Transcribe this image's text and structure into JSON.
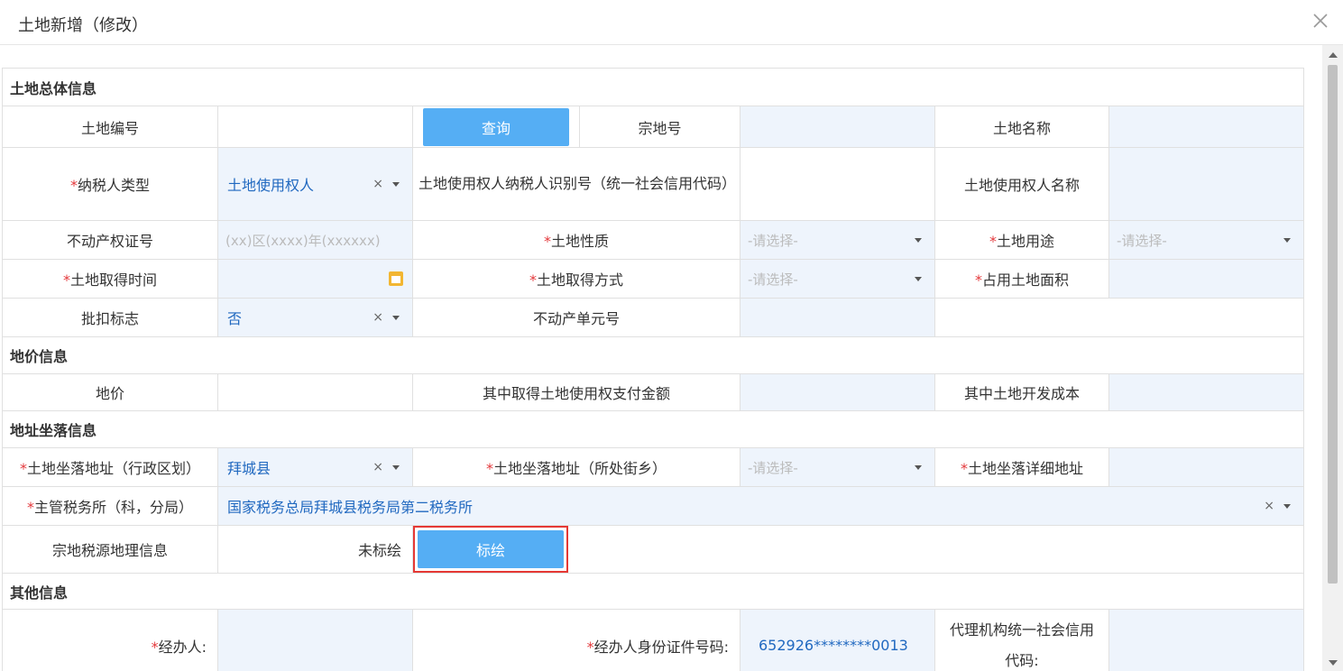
{
  "dialog": {
    "title": "土地新增（修改）"
  },
  "sections": {
    "general": "土地总体信息",
    "price": "地价信息",
    "address": "地址坐落信息",
    "other": "其他信息"
  },
  "fields": {
    "land_no": "土地编号",
    "query_button": "查询",
    "parcel_no": "宗地号",
    "land_name": "土地名称",
    "taxpayer_type": "纳税人类型",
    "taxpayer_type_value": "土地使用权人",
    "user_tax_id": "土地使用权人纳税人识别号（统一社会信用代码）",
    "user_name": "土地使用权人名称",
    "property_cert_no": "不动产权证号",
    "property_cert_placeholder": "(xx)区(xxxx)年(xxxxxx)",
    "land_nature": "土地性质",
    "land_use": "土地用途",
    "select_placeholder": "-请选择-",
    "acquire_time": "土地取得时间",
    "acquire_method": "土地取得方式",
    "occupied_area": "占用土地面积",
    "deduction_flag": "批扣标志",
    "deduction_flag_value": "否",
    "property_unit_no": "不动产单元号",
    "land_price": "地价",
    "use_right_payment": "其中取得土地使用权支付金额",
    "development_cost": "其中土地开发成本",
    "addr_district": "土地坐落地址（行政区划）",
    "addr_district_value": "拜城县",
    "addr_street": "土地坐落地址（所处街乡）",
    "addr_detail": "土地坐落详细地址",
    "tax_office": "主管税务所（科，分局）",
    "tax_office_value": "国家税务总局拜城县税务局第二税务所",
    "geo_info": "宗地税源地理信息",
    "geo_status": "未标绘",
    "plot_button": "标绘",
    "handler": "经办人:",
    "handler_id": "经办人身份证件号码:",
    "handler_id_value": "652926********0013",
    "agency_code": "代理机构统一社会信用代码:"
  },
  "icons": {
    "clear": "×",
    "close": "close-icon"
  },
  "colors": {
    "button": "#55aef4",
    "required": "#e4393c",
    "value_text": "#2169c0",
    "input_bg": "#eef4fc",
    "highlight": "#e53935"
  }
}
